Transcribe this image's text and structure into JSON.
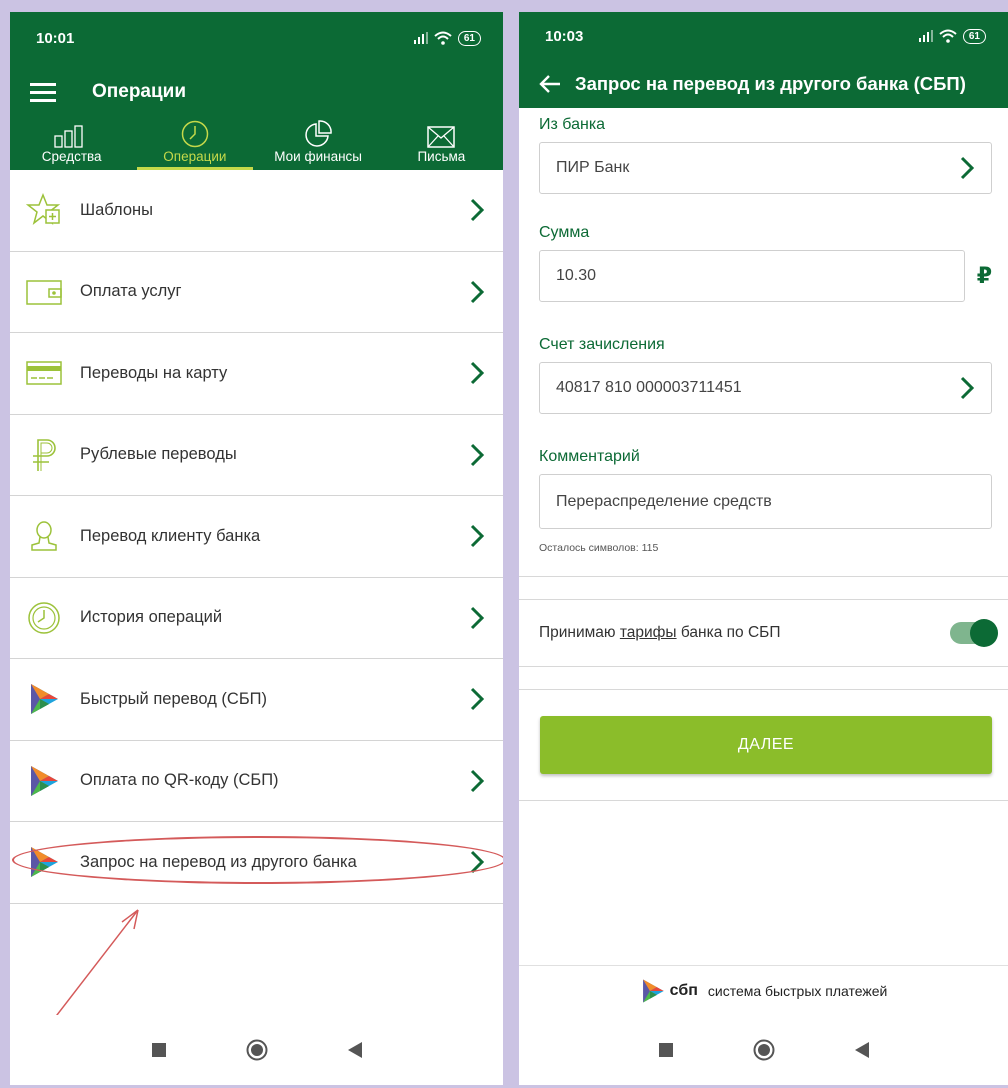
{
  "left": {
    "status": {
      "time": "10:01",
      "battery": "61"
    },
    "appbar": {
      "title": "Операции"
    },
    "tabs": [
      {
        "label": "Средства"
      },
      {
        "label": "Операции"
      },
      {
        "label": "Мои финансы"
      },
      {
        "label": "Письма"
      }
    ],
    "items": [
      {
        "label": "Шаблоны"
      },
      {
        "label": "Оплата услуг"
      },
      {
        "label": "Переводы на карту"
      },
      {
        "label": "Рублевые переводы"
      },
      {
        "label": "Перевод клиенту банка"
      },
      {
        "label": "История операций"
      },
      {
        "label": "Быстрый перевод (СБП)"
      },
      {
        "label": "Оплата по QR-коду (СБП)"
      },
      {
        "label": "Запрос на перевод из другого банка"
      }
    ]
  },
  "right": {
    "status": {
      "time": "10:03",
      "battery": "61"
    },
    "appbar": {
      "title": "Запрос на перевод из другого банка (СБП)"
    },
    "bank": {
      "label": "Из банка",
      "value": "ПИР Банк"
    },
    "amount": {
      "label": "Сумма",
      "value": "10.30",
      "currency": "₽"
    },
    "account": {
      "label": "Счет зачисления",
      "value": "40817 810 000003711451"
    },
    "comment": {
      "label": "Комментарий",
      "value": "Перераспределение средств",
      "hint": "Осталось символов: 115"
    },
    "tariff": {
      "prefix": "Принимаю ",
      "link": "тарифы",
      "suffix": " банка по СБП"
    },
    "next_label": "ДАЛЕЕ",
    "footer": {
      "brand": "сбп",
      "text": "система быстрых платежей"
    }
  },
  "colors": {
    "brand_green": "#0c6a35",
    "accent_lime": "#c5d94a",
    "button_green": "#8bbd2a",
    "annotation_red": "#d45a5a"
  }
}
